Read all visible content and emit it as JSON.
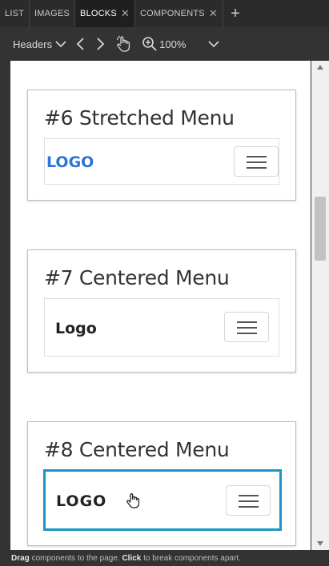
{
  "tabs": [
    {
      "label": "LIST",
      "active": false,
      "closable": false
    },
    {
      "label": "IMAGES",
      "active": false,
      "closable": false
    },
    {
      "label": "BLOCKS",
      "active": true,
      "closable": true
    },
    {
      "label": "COMPONENTS",
      "active": false,
      "closable": true
    }
  ],
  "tab_close_glyph": "✕",
  "tab_add_glyph": "+",
  "toolbar": {
    "category": "Headers",
    "zoom": "100%"
  },
  "cards": [
    {
      "title": "#6 Stretched Menu",
      "logo": "LOGO"
    },
    {
      "title": "#7 Centered Menu",
      "logo": "Logo"
    },
    {
      "title": "#8 Centered Menu",
      "logo": "LOGO"
    }
  ],
  "status": {
    "drag": "Drag",
    "drag_text": " components to the page. ",
    "click": "Click",
    "click_text": " to break components apart."
  },
  "colors": {
    "selection": "#1a95c4",
    "logo_blue": "#2a76d2"
  }
}
